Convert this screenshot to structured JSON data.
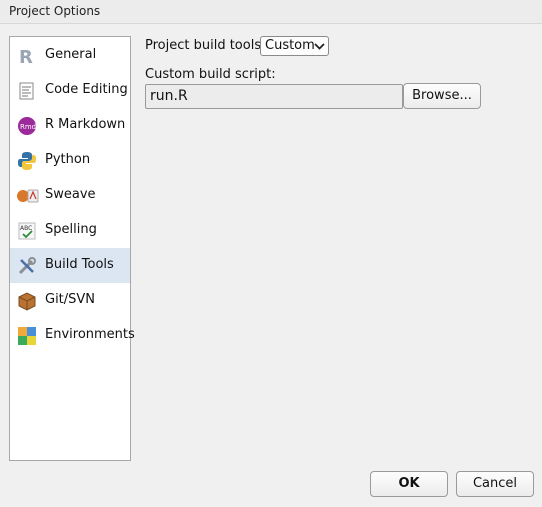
{
  "window": {
    "title": "Project Options"
  },
  "sidebar": {
    "items": [
      {
        "label": "General",
        "icon": "r-logo-icon"
      },
      {
        "label": "Code Editing",
        "icon": "code-file-icon"
      },
      {
        "label": "R Markdown",
        "icon": "rmd-icon"
      },
      {
        "label": "Python",
        "icon": "python-icon"
      },
      {
        "label": "Sweave",
        "icon": "sweave-pdf-icon"
      },
      {
        "label": "Spelling",
        "icon": "spellcheck-icon"
      },
      {
        "label": "Build Tools",
        "icon": "build-tools-icon",
        "selected": true
      },
      {
        "label": "Git/SVN",
        "icon": "git-package-icon"
      },
      {
        "label": "Environments",
        "icon": "environments-icon"
      }
    ]
  },
  "build": {
    "tools_label": "Project build tools:",
    "tools_value": "Custom",
    "script_label": "Custom build script:",
    "script_value": "run.R",
    "browse_label": "Browse..."
  },
  "footer": {
    "ok_label": "OK",
    "cancel_label": "Cancel"
  },
  "colors": {
    "selected_bg": "#dce6f3",
    "panel_bg": "#f0f0f0"
  }
}
